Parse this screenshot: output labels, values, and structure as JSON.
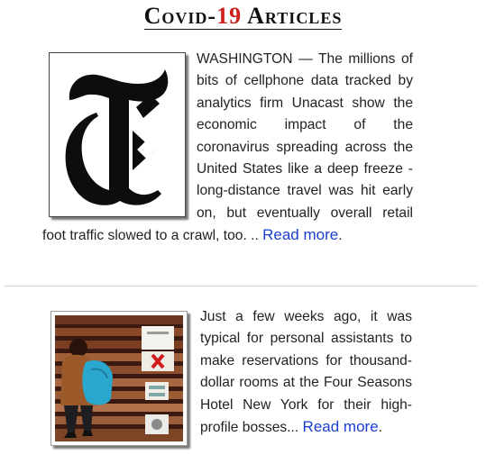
{
  "heading": {
    "prefix": "Covid-",
    "number": "19",
    "suffix": " Articles"
  },
  "articles": [
    {
      "image_icon": "nyt-t-logo",
      "body": "WASHINGTON — The millions of bits of cellphone data tracked by analytics firm Unacast show the economic impact of the coronavirus spreading across the United States like a deep freeze - long-distance travel was hit early on, but eventually overall retail foot traffic slowed to a crawl, too. .. ",
      "read_more": "Read more",
      "trail": "."
    },
    {
      "image_icon": "elevator-passenger-photo",
      "body": "Just a few weeks ago, it was typical for personal assistants to make reservations for thousand-dollar rooms at the Four Seasons Hotel New York for their high-profile bosses... ",
      "read_more": "Read more",
      "trail": "."
    }
  ],
  "colors": {
    "heading_number": "#d0201b",
    "link": "#1a3fcf",
    "divider": "#cfcfcf"
  }
}
